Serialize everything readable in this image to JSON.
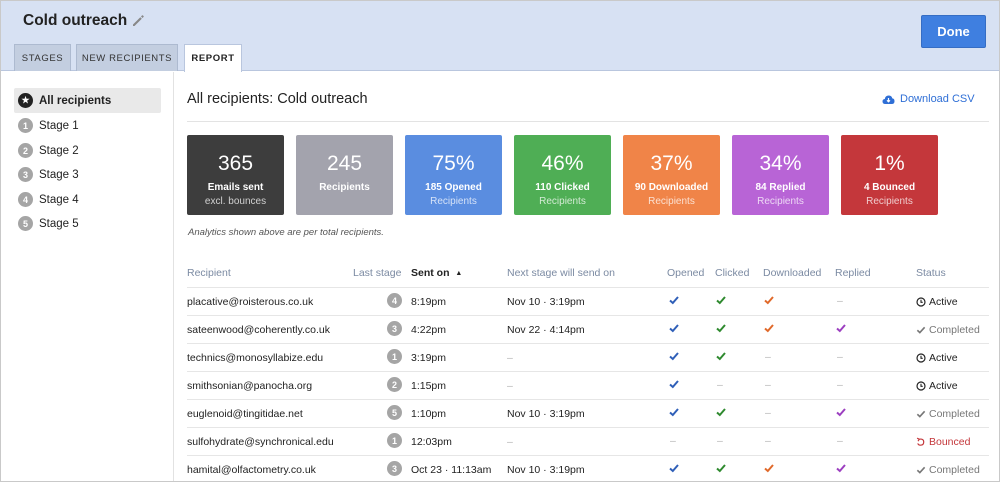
{
  "header": {
    "title": "Cold outreach",
    "done_label": "Done",
    "tabs": [
      {
        "label": "STAGES",
        "active": false
      },
      {
        "label": "NEW RECIPIENTS",
        "active": false
      },
      {
        "label": "REPORT",
        "active": true
      }
    ]
  },
  "sidebar": {
    "items": [
      {
        "label": "All recipients",
        "badge": "★",
        "active": true
      },
      {
        "label": "Stage 1",
        "badge": "1"
      },
      {
        "label": "Stage 2",
        "badge": "2"
      },
      {
        "label": "Stage 3",
        "badge": "3"
      },
      {
        "label": "Stage 4",
        "badge": "4"
      },
      {
        "label": "Stage 5",
        "badge": "5"
      }
    ]
  },
  "main": {
    "title": "All recipients: Cold outreach",
    "download_label": "Download CSV",
    "analytics_note": "Analytics shown above are per total recipients."
  },
  "cards": [
    {
      "value": "365",
      "line1": "Emails sent",
      "line2": "excl. bounces",
      "color": "#3d3d3d"
    },
    {
      "value": "245",
      "line1": "Recipients",
      "line2": "",
      "color": "#a3a3ad"
    },
    {
      "value": "75%",
      "line1": "185 Opened",
      "line2": "Recipients",
      "color": "#5a8de0"
    },
    {
      "value": "46%",
      "line1": "110 Clicked",
      "line2": "Recipients",
      "color": "#4fae55"
    },
    {
      "value": "37%",
      "line1": "90 Downloaded",
      "line2": "Recipients",
      "color": "#f08448"
    },
    {
      "value": "34%",
      "line1": "84 Replied",
      "line2": "Recipients",
      "color": "#b864d6"
    },
    {
      "value": "1%",
      "line1": "4 Bounced",
      "line2": "Recipients",
      "color": "#c4373b"
    }
  ],
  "table": {
    "columns": {
      "recipient": "Recipient",
      "last_stage": "Last stage",
      "sent_on": "Sent on",
      "next_stage": "Next stage will send on",
      "opened": "Opened",
      "clicked": "Clicked",
      "downloaded": "Downloaded",
      "replied": "Replied",
      "status": "Status"
    },
    "sort_indicator": "▲",
    "dash": "–",
    "check_colors": {
      "opened": "#2f5fb8",
      "clicked": "#2f8a2f",
      "downloaded": "#e0692a",
      "replied": "#9c3fc0"
    },
    "rows": [
      {
        "email": "placative@roisterous.co.uk",
        "stage": "4",
        "sent": "8:19pm",
        "next": "Nov 10 · 3:19pm",
        "opened": true,
        "clicked": true,
        "downloaded": true,
        "replied": false,
        "status": "Active"
      },
      {
        "email": "sateenwood@coherently.co.uk",
        "stage": "3",
        "sent": "4:22pm",
        "next": "Nov 22 · 4:14pm",
        "opened": true,
        "clicked": true,
        "downloaded": true,
        "replied": true,
        "status": "Completed"
      },
      {
        "email": "technics@monosyllabize.edu",
        "stage": "1",
        "sent": "3:19pm",
        "next": "–",
        "opened": true,
        "clicked": true,
        "downloaded": false,
        "replied": false,
        "status": "Active"
      },
      {
        "email": "smithsonian@panocha.org",
        "stage": "2",
        "sent": "1:15pm",
        "next": "–",
        "opened": true,
        "clicked": false,
        "downloaded": false,
        "replied": false,
        "status": "Active"
      },
      {
        "email": "euglenoid@tingitidae.net",
        "stage": "5",
        "sent": "1:10pm",
        "next": "Nov 10 · 3:19pm",
        "opened": true,
        "clicked": true,
        "downloaded": false,
        "replied": true,
        "status": "Completed"
      },
      {
        "email": "sulfohydrate@synchronical.edu",
        "stage": "1",
        "sent": "12:03pm",
        "next": "–",
        "opened": false,
        "clicked": false,
        "downloaded": false,
        "replied": false,
        "status": "Bounced"
      },
      {
        "email": "hamital@olfactometry.co.uk",
        "stage": "3",
        "sent": "Oct 23 · 11:13am",
        "next": "Nov 10 · 3:19pm",
        "opened": true,
        "clicked": true,
        "downloaded": true,
        "replied": true,
        "status": "Completed"
      }
    ]
  }
}
